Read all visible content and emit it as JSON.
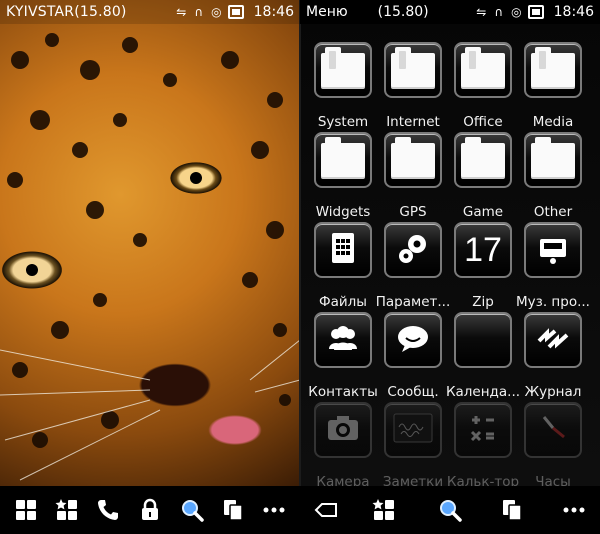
{
  "left_status": {
    "operator": "KYIVSTAR(15.80)",
    "time": "18:46"
  },
  "right_status": {
    "title": "Меню",
    "balance": "(15.80)",
    "time": "18:46"
  },
  "menu": {
    "labels": [
      "System",
      "Internet",
      "Office",
      "Media",
      "Widgets",
      "GPS",
      "Game",
      "Other",
      "Файлы",
      "Парамет...",
      "Zip",
      "Муз. про...",
      "Контакты",
      "Сообщ.",
      "Календа...",
      "Журнал",
      "Камера",
      "Заметки",
      "Кальк-тор",
      "Часы"
    ],
    "zip_day": "17"
  },
  "icons": {
    "status": [
      "bluetooth-icon",
      "headset-icon",
      "signal-icon",
      "battery-icon"
    ],
    "bottom": [
      "menu-grid-icon",
      "favorites-icon",
      "phone-icon",
      "lock-icon",
      "search-icon",
      "multitask-icon",
      "more-icon",
      "back-icon",
      "favorites-icon",
      "search-icon",
      "multitask-icon",
      "more-icon"
    ]
  },
  "colors": {
    "tile_border": "#7a7a7a",
    "background": "#000000"
  }
}
